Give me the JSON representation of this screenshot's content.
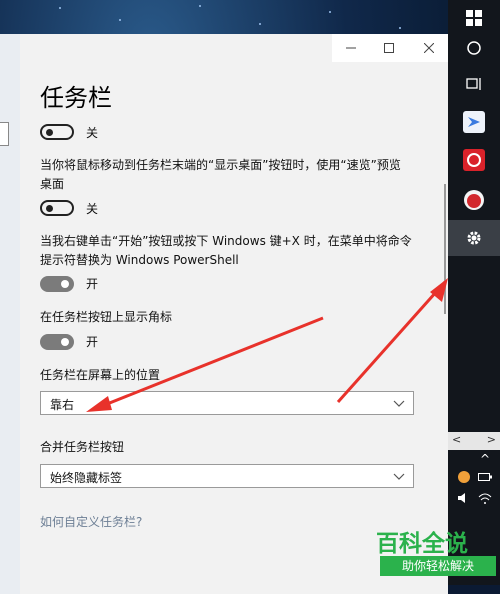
{
  "window": {
    "title": "任务栏",
    "controls": {
      "minimize": "—",
      "maximize": "☐",
      "close": "✕"
    }
  },
  "settings": [
    {
      "state": "关"
    },
    {
      "label": "当你将鼠标移动到任务栏末端的“显示桌面”按钮时，使用“速览”预览桌面",
      "state": "关"
    },
    {
      "label": "当我右键单击“开始”按钮或按下 Windows 键+X 时，在菜单中将命令提示符替换为 Windows PowerShell",
      "state": "开"
    },
    {
      "label": "在任务栏按钮上显示角标",
      "state": "开"
    }
  ],
  "location": {
    "label": "任务栏在屏幕上的位置",
    "value": "靠右"
  },
  "combine": {
    "label": "合并任务栏按钮",
    "value": "始终隐藏标签"
  },
  "help_link": "如何自定义任务栏?",
  "taskbar_icons": [
    "windows-logo-icon",
    "cortana-icon",
    "task-view-icon",
    "feishu-app-icon",
    "netease-music-icon",
    "app-icon-red",
    "settings-gear-icon"
  ],
  "tray": {
    "left": "<",
    "right": ">",
    "expand": "^"
  },
  "watermark": {
    "main": "百科全说",
    "sub": "助你轻松解决"
  },
  "colors": {
    "arrow": "#e8322b",
    "watermark_green": "#2bb24c",
    "taskbar": "#12161c"
  }
}
